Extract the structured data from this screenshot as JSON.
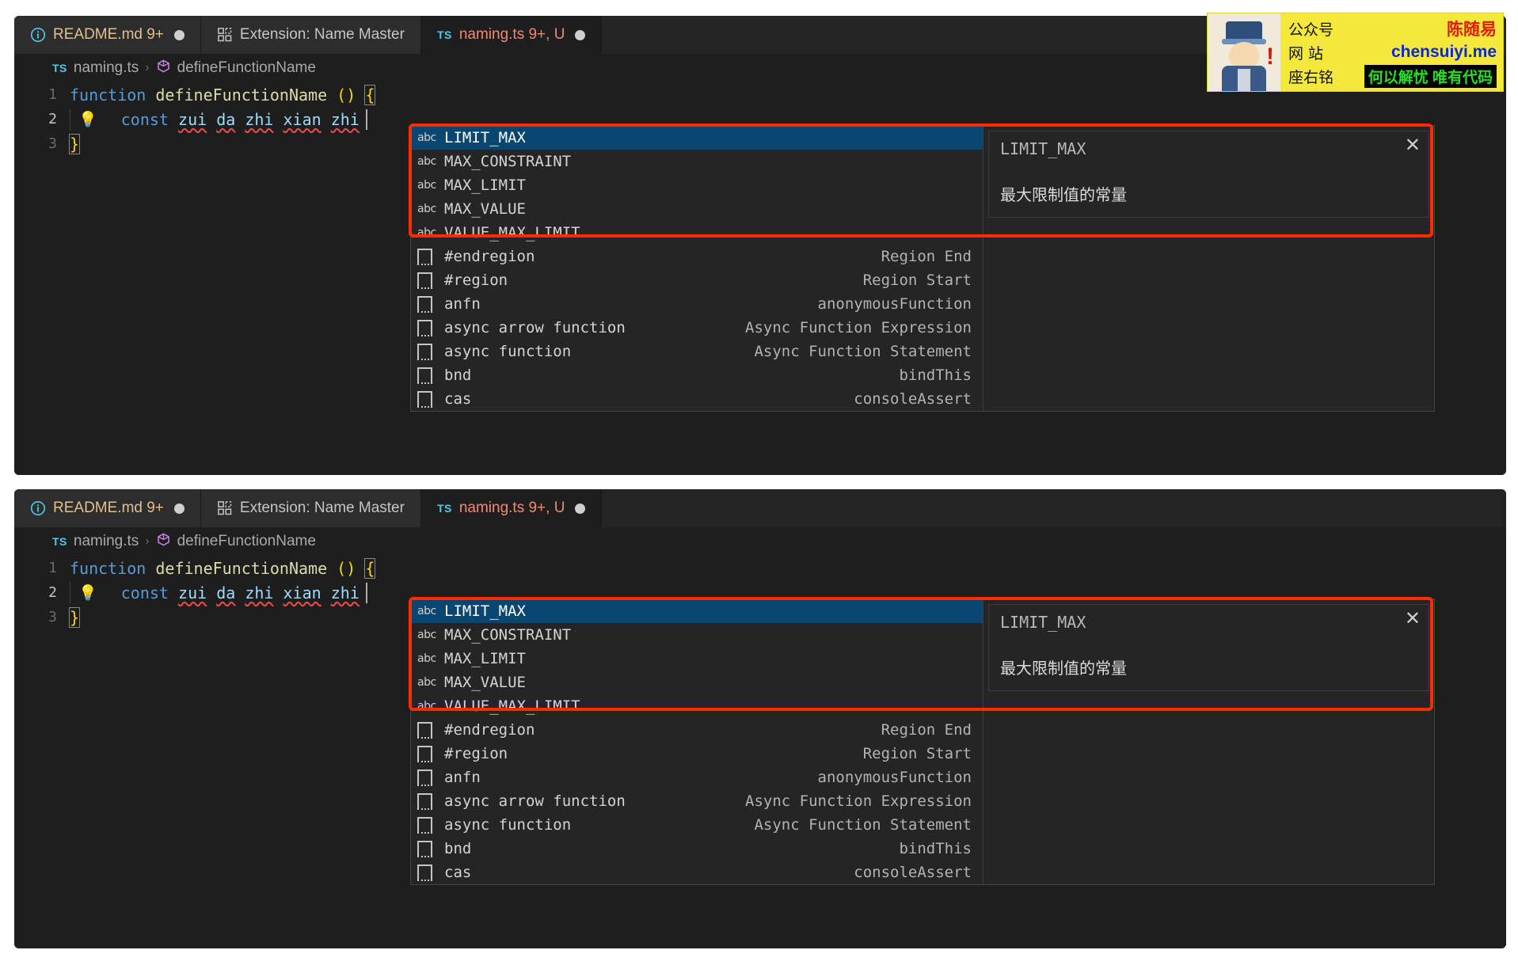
{
  "window": {
    "background": "#ffffff",
    "editor_background": "#1e1e1e",
    "accent_red": "#ff2b00",
    "selection_blue": "#094771"
  },
  "tabs": [
    {
      "icon": "info-circle-icon",
      "label": "README.md 9+",
      "state": "modified-dot",
      "color": "#e2c08d"
    },
    {
      "icon": "extensions-icon",
      "label": "Extension: Name Master",
      "state": "none",
      "color": "#c5c5c5"
    },
    {
      "icon": "typescript-icon",
      "label": "naming.ts 9+, U",
      "state": "modified-dot",
      "color": "#f48771"
    }
  ],
  "breadcrumb": {
    "file_icon": "TS",
    "file": "naming.ts",
    "separator": "›",
    "symbol_icon": "symbol-method-icon",
    "symbol": "defineFunctionName"
  },
  "code": {
    "lines": [
      {
        "num": "1",
        "tokens": [
          {
            "t": "function",
            "c": "kw-fn"
          },
          {
            "t": " ",
            "c": "plain"
          },
          {
            "t": "defineFunctionName",
            "c": "fn-name"
          },
          {
            "t": " ",
            "c": "plain"
          },
          {
            "t": "()",
            "c": "punct"
          },
          {
            "t": " ",
            "c": "plain"
          },
          {
            "t": "{",
            "c": "brace-hl"
          }
        ]
      },
      {
        "num": "2",
        "bulb": true,
        "tokens": [
          {
            "t": "const",
            "c": "kw-const"
          },
          {
            "t": " ",
            "c": "plain"
          },
          {
            "t": "zui",
            "c": "var-blue squiggle"
          },
          {
            "t": " ",
            "c": "plain"
          },
          {
            "t": "da",
            "c": "var-blue squiggle"
          },
          {
            "t": " ",
            "c": "plain"
          },
          {
            "t": "zhi",
            "c": "var-blue squiggle"
          },
          {
            "t": " ",
            "c": "plain"
          },
          {
            "t": "xian",
            "c": "var-blue squiggle"
          },
          {
            "t": " ",
            "c": "plain"
          },
          {
            "t": "zhi",
            "c": "var-blue squiggle"
          }
        ]
      },
      {
        "num": "3",
        "tokens": [
          {
            "t": "}",
            "c": "brace-hl"
          }
        ]
      }
    ]
  },
  "suggest": {
    "words": [
      {
        "icon": "abc-icon",
        "icon_text": "abc",
        "label": "LIMIT_MAX",
        "detail": "",
        "selected": true
      },
      {
        "icon": "abc-icon",
        "icon_text": "abc",
        "label": "MAX_CONSTRAINT",
        "detail": "",
        "selected": false
      },
      {
        "icon": "abc-icon",
        "icon_text": "abc",
        "label": "MAX_LIMIT",
        "detail": "",
        "selected": false
      },
      {
        "icon": "abc-icon",
        "icon_text": "abc",
        "label": "MAX_VALUE",
        "detail": "",
        "selected": false
      },
      {
        "icon": "abc-icon",
        "icon_text": "abc",
        "label": "VALUE_MAX_LIMIT",
        "detail": "",
        "selected": false
      }
    ],
    "snippets": [
      {
        "icon": "snippet-icon",
        "label": "#endregion",
        "detail": "Region End"
      },
      {
        "icon": "snippet-icon",
        "label": "#region",
        "detail": "Region Start"
      },
      {
        "icon": "snippet-icon",
        "label": "anfn",
        "detail": "anonymousFunction"
      },
      {
        "icon": "snippet-icon",
        "label": "async arrow function",
        "detail": "Async Function Expression"
      },
      {
        "icon": "snippet-icon",
        "label": "async function",
        "detail": "Async Function Statement"
      },
      {
        "icon": "snippet-icon",
        "label": "bnd",
        "detail": "bindThis"
      },
      {
        "icon": "snippet-icon",
        "label": "cas",
        "detail": "consoleAssert"
      }
    ],
    "docs": {
      "title": "LIMIT_MAX",
      "body": "最大限制值的常量",
      "close_icon": "close-icon",
      "close_glyph": "✕"
    }
  },
  "watermark": {
    "avatar_icon": "mascot-avatar-icon",
    "rows": [
      {
        "key": "公众号",
        "value": "陈随易",
        "style": "red"
      },
      {
        "key": "网 站",
        "value": "chensuiyi.me",
        "style": "blue"
      },
      {
        "key": "座右铭",
        "value": "何以解忧 唯有代码",
        "style": "green-on-black"
      }
    ]
  }
}
